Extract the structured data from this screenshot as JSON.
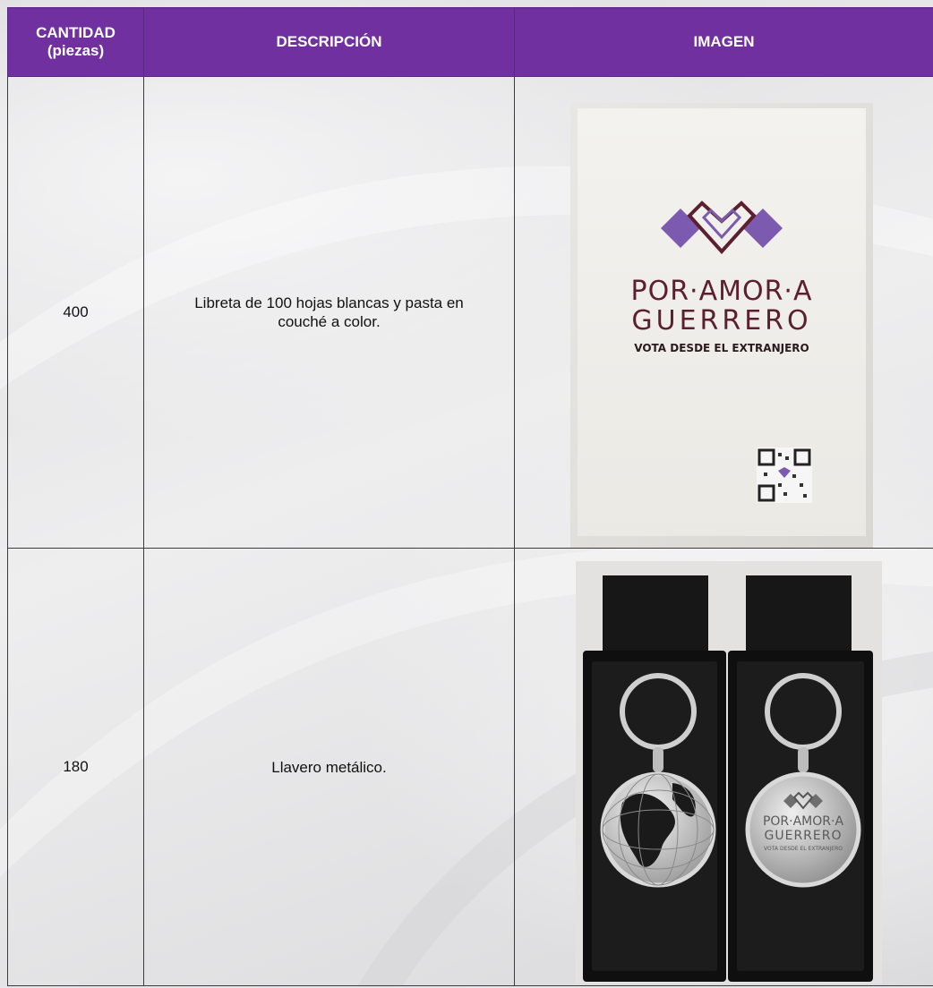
{
  "table": {
    "headers": {
      "quantity": "CANTIDAD (piezas)",
      "description": "DESCRIPCIÓN",
      "image": "IMAGEN"
    },
    "rows": [
      {
        "quantity": "400",
        "description": "Libreta de 100 hojas blancas y pasta en couché a color.",
        "image_icon": "notebook-photo",
        "image_text": {
          "line1": "POR·AMOR·A",
          "line2": "GUERRERO",
          "line3": "VOTA DESDE EL EXTRANJERO"
        }
      },
      {
        "quantity": "180",
        "description": "Llavero metálico.",
        "image_icon": "keychain-photo",
        "image_text": {
          "line1": "POR·AMOR·A",
          "line2": "GUERRERO",
          "line3": "VOTA DESDE EL EXTRANJERO"
        }
      }
    ]
  },
  "colors": {
    "header_bg": "#7030a0",
    "header_text": "#ffffff",
    "logo_purple": "#7b5ab0",
    "logo_maroon": "#5c1f2e"
  }
}
